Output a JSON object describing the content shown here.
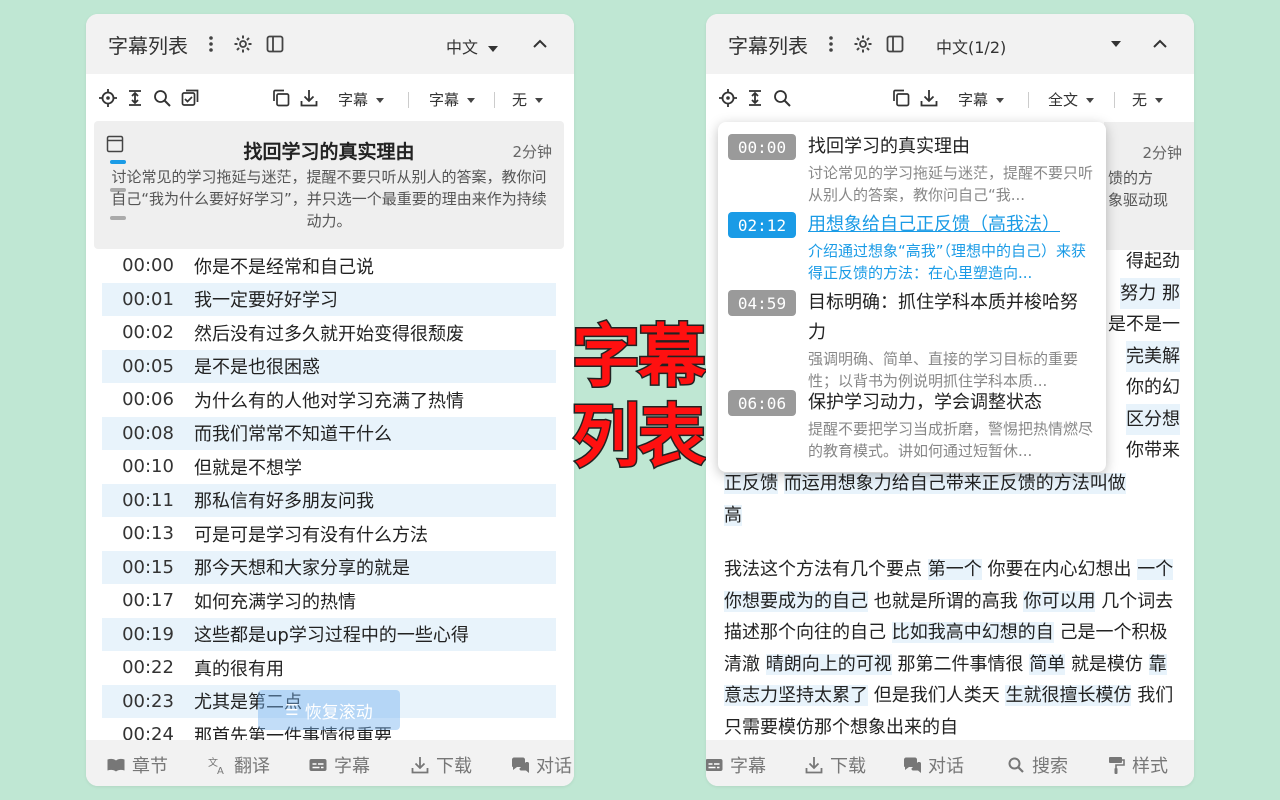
{
  "overlay_text": [
    "字幕",
    "列表"
  ],
  "left": {
    "header": {
      "title": "字幕列表",
      "language": "中文"
    },
    "toolbar": {
      "dd1": "字幕",
      "dd2": "字幕",
      "dd3": "无"
    },
    "chapter": {
      "title": "找回学习的真实理由",
      "duration": "2分钟",
      "description": "讨论常见的学习拖延与迷茫，提醒不要只听从别人的答案，教你问自己“我为什么要好好学习”，并只选一个最重要的理由来作为持续动力。"
    },
    "subtitles": [
      {
        "time": "00:00",
        "text": "你是不是经常和自己说"
      },
      {
        "time": "00:01",
        "text": "我一定要好好学习"
      },
      {
        "time": "00:02",
        "text": "然后没有过多久就开始变得很颓废"
      },
      {
        "time": "00:05",
        "text": "是不是也很困惑"
      },
      {
        "time": "00:06",
        "text": "为什么有的人他对学习充满了热情"
      },
      {
        "time": "00:08",
        "text": "而我们常常不知道干什么"
      },
      {
        "time": "00:10",
        "text": "但就是不想学"
      },
      {
        "time": "00:11",
        "text": "那私信有好多朋友问我"
      },
      {
        "time": "00:13",
        "text": "可是可是学习有没有什么方法"
      },
      {
        "time": "00:15",
        "text": "那今天想和大家分享的就是"
      },
      {
        "time": "00:17",
        "text": "如何充满学习的热情"
      },
      {
        "time": "00:19",
        "text": "这些都是up学习过程中的一些心得"
      },
      {
        "time": "00:22",
        "text": "真的很有用"
      },
      {
        "time": "00:23",
        "text": "尤其是第二点"
      },
      {
        "time": "00:24",
        "text": "那首先第一件事情很重要"
      }
    ],
    "resume_button": "恢复滚动",
    "footer": [
      "章节",
      "翻译",
      "字幕",
      "下载",
      "对话"
    ]
  },
  "right": {
    "header": {
      "title": "字幕列表",
      "language": "中文(1/2)"
    },
    "toolbar": {
      "dd1": "字幕",
      "dd2": "全文",
      "dd3": "无"
    },
    "popup": [
      {
        "time": "00:00",
        "title": "找回学习的真实理由",
        "desc": "讨论常见的学习拖延与迷茫，提醒不要只听从别人的答案，教你问自己“我...",
        "active": false
      },
      {
        "time": "02:12",
        "title": "用想象给自己正反馈（高我法）",
        "desc": "介绍通过想象“高我”（理想中的自己）来获得正反馈的方法：在心里塑造向...",
        "active": true
      },
      {
        "time": "04:59",
        "title": "目标明确：抓住学科本质并梭哈努力",
        "desc": "强调明确、简单、直接的学习目标的重要性；以背书为例说明抓住学科本质...",
        "active": false
      },
      {
        "time": "06:06",
        "title": "保护学习动力，学会调整状态",
        "desc": "提醒不要把学习当成折磨，警惕把热情燃尽的教育模式。讲如何通过短暂休...",
        "active": false
      }
    ],
    "behind_chapter": {
      "duration": "2分钟",
      "line1": "馈的方",
      "line2": "象驱动现"
    },
    "side_fragments": [
      "得起劲",
      "努力 那",
      "是不是一",
      "完美解",
      "你的幻",
      "区分想",
      "你带来"
    ],
    "paragraph1": [
      "正反馈",
      "而运用想象力给自己带来正反馈的方法叫做",
      "高"
    ],
    "paragraph2": [
      "我法这个方法有几个要点",
      "第一个",
      "你要在内心幻想出",
      "一个你想要成为的自己",
      "也就是所谓的高我",
      "你可以用",
      "几个词去描述那个向往的自己",
      "比如我高中幻想的自",
      "己是一个积极清澈",
      "晴朗向上的可视",
      "那第二件事情很",
      "简单",
      "就是模仿",
      "靠意志力坚持太累了",
      "但是我们人类天",
      "生就很擅长模仿",
      "我们只需要模仿那个想象出来的自"
    ],
    "footer": [
      "字幕",
      "下载",
      "对话",
      "搜索",
      "样式"
    ]
  }
}
